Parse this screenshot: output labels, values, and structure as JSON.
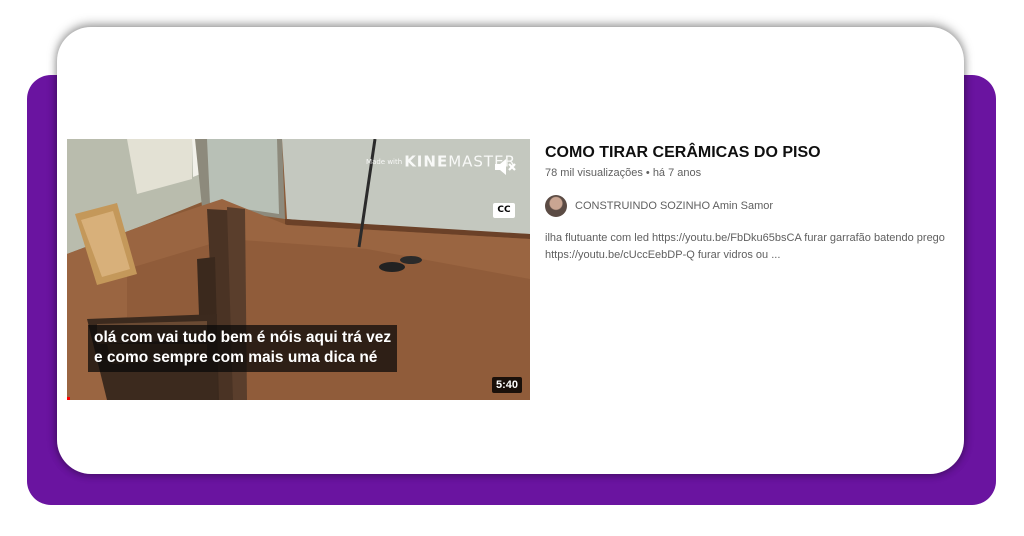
{
  "video": {
    "title": "COMO TIRAR CERÂMICAS DO PISO",
    "views": "78 mil visualizações",
    "separator": "•",
    "age": "há 7 anos",
    "channel": "CONSTRUINDO SOZINHO Amin Samor",
    "description": "ilha flutuante com led https://youtu.be/FbDku65bsCA furar garrafão batendo prego https://youtu.be/cUccEebDP-Q furar vidros ou ..."
  },
  "thumbnail": {
    "watermark_made": "Made with",
    "watermark_kine": "KINE",
    "watermark_master": "MASTER",
    "cc_label": "CC",
    "caption_line1": "olá com vai tudo bem é nóis aqui trá vez",
    "caption_line2": "e como sempre com mais uma dica né",
    "duration": "5:40",
    "mute_icon": "speaker-muted-icon"
  },
  "colors": {
    "frame_purple": "#6a14a0",
    "progress_red": "#ff0000"
  }
}
